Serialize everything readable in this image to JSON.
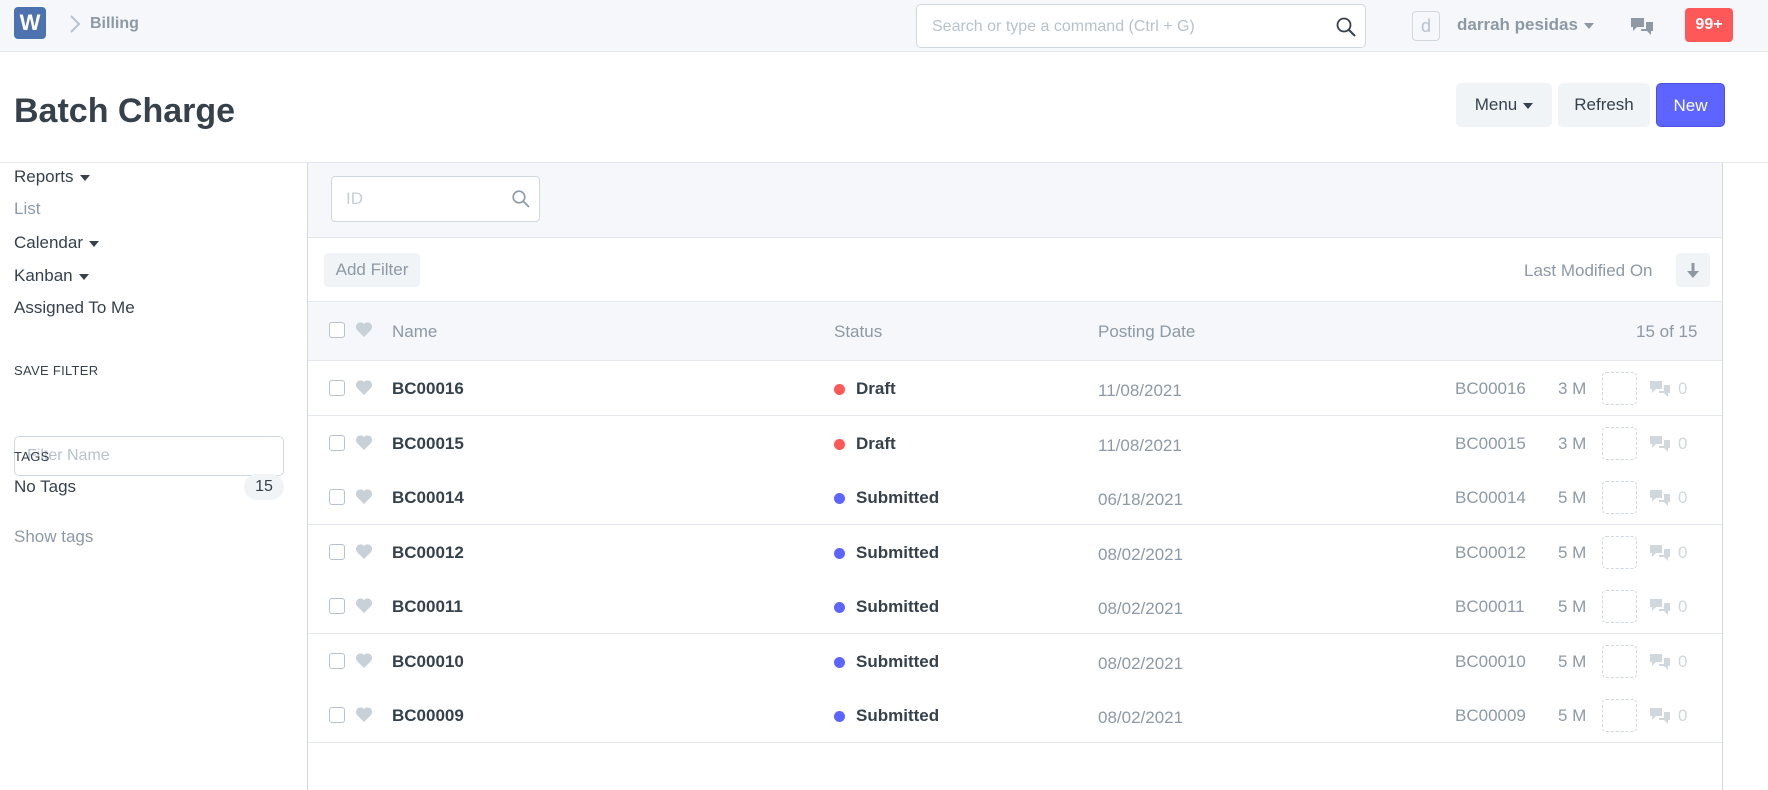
{
  "navbar": {
    "logo_letter": "W",
    "breadcrumb": "Billing",
    "search_placeholder": "Search or type a command (Ctrl + G)",
    "avatar_letter": "d",
    "user_name": "darrah pesidas",
    "notification_count": "99+"
  },
  "page": {
    "title": "Batch Charge",
    "menu_label": "Menu",
    "refresh_label": "Refresh",
    "new_label": "New"
  },
  "sidebar": {
    "reports": "Reports",
    "list": "List",
    "calendar": "Calendar",
    "kanban": "Kanban",
    "assigned_to_me": "Assigned To Me",
    "save_filter_heading": "SAVE FILTER",
    "filter_name_placeholder": "Filter Name",
    "tags_heading": "TAGS",
    "no_tags_label": "No Tags",
    "no_tags_count": "15",
    "show_tags": "Show tags"
  },
  "list": {
    "id_placeholder": "ID",
    "add_filter": "Add Filter",
    "sort_label": "Last Modified On",
    "columns": {
      "name": "Name",
      "status": "Status",
      "posting_date": "Posting Date",
      "count": "15 of 15"
    },
    "rows": [
      {
        "name": "BC00016",
        "status": "Draft",
        "date": "11/08/2021",
        "id": "BC00016",
        "age": "3 M",
        "comments": "0"
      },
      {
        "name": "BC00015",
        "status": "Draft",
        "date": "11/08/2021",
        "id": "BC00015",
        "age": "3 M",
        "comments": "0"
      },
      {
        "name": "BC00014",
        "status": "Submitted",
        "date": "06/18/2021",
        "id": "BC00014",
        "age": "5 M",
        "comments": "0"
      },
      {
        "name": "BC00012",
        "status": "Submitted",
        "date": "08/02/2021",
        "id": "BC00012",
        "age": "5 M",
        "comments": "0"
      },
      {
        "name": "BC00011",
        "status": "Submitted",
        "date": "08/02/2021",
        "id": "BC00011",
        "age": "5 M",
        "comments": "0"
      },
      {
        "name": "BC00010",
        "status": "Submitted",
        "date": "08/02/2021",
        "id": "BC00010",
        "age": "5 M",
        "comments": "0"
      },
      {
        "name": "BC00009",
        "status": "Submitted",
        "date": "08/02/2021",
        "id": "BC00009",
        "age": "5 M",
        "comments": "0"
      }
    ]
  },
  "colors": {
    "draft": "#ff5858",
    "submitted": "#5e64ff",
    "primary": "#5e64ff"
  },
  "icons": [
    "app-logo-icon",
    "chevron-right-icon",
    "search-icon",
    "caret-down-icon",
    "chat-icon",
    "heart-icon",
    "comment-icon",
    "sort-arrow-icon"
  ]
}
